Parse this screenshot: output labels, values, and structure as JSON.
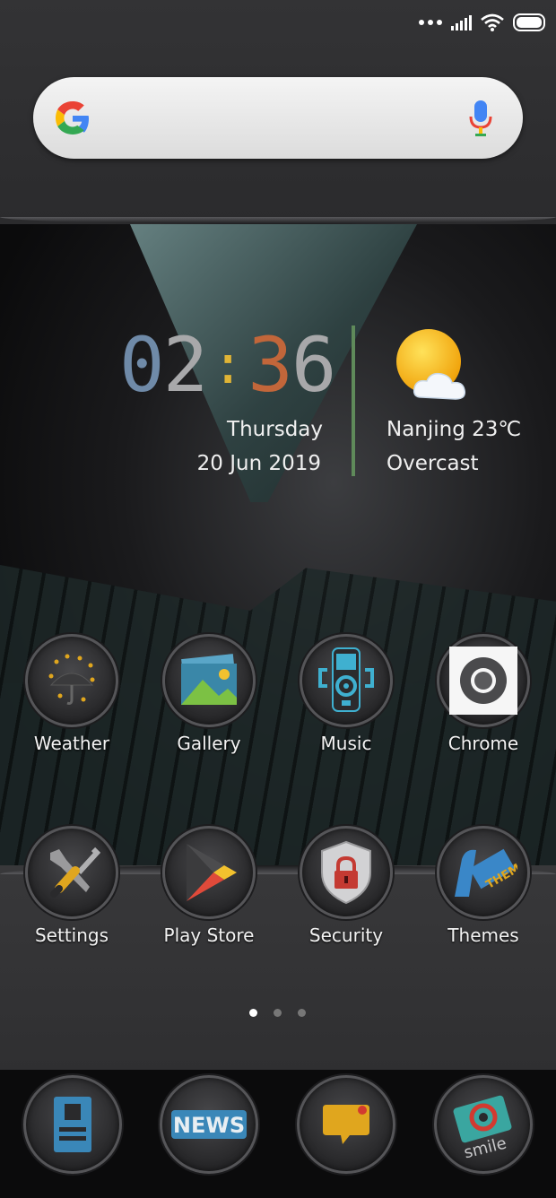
{
  "search": {
    "placeholder": ""
  },
  "clock": {
    "h1": "0",
    "h2": "2",
    "colon": ":",
    "m1": "3",
    "m2": "6",
    "day": "Thursday",
    "date": "20 Jun 2019"
  },
  "weather": {
    "city": "Nanjing  23℃",
    "condition": "Overcast"
  },
  "apps": [
    {
      "label": "Weather"
    },
    {
      "label": "Gallery"
    },
    {
      "label": "Music"
    },
    {
      "label": "Chrome"
    },
    {
      "label": "Settings"
    },
    {
      "label": "Play Store"
    },
    {
      "label": "Security"
    },
    {
      "label": "Themes"
    }
  ],
  "dock": [
    {
      "icon": "contacts-icon"
    },
    {
      "icon": "news-icon",
      "text": "NEWS"
    },
    {
      "icon": "messages-icon"
    },
    {
      "icon": "camera-icon",
      "text": "smile"
    }
  ],
  "pager": {
    "count": 3,
    "active": 0
  },
  "colors": {
    "clock_blue": "#6f8aa8",
    "clock_orange": "#c2663a",
    "clock_colon": "#e0b436",
    "divider_green": "#5f8a5a"
  }
}
